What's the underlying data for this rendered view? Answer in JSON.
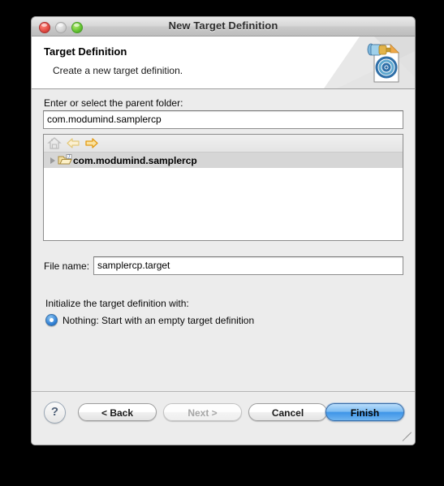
{
  "window": {
    "title": "New Target Definition",
    "controls": [
      {
        "name": "close",
        "icon": "close-traffic-light"
      },
      {
        "name": "minimize",
        "icon": "minimize-traffic-light"
      },
      {
        "name": "zoom",
        "icon": "zoom-traffic-light"
      }
    ]
  },
  "header": {
    "title": "Target Definition",
    "subtitle": "Create a new target definition.",
    "icon": "target-definition-document-icon"
  },
  "form": {
    "parent_folder_label": "Enter or select the parent folder:",
    "parent_folder_value": "com.modumind.samplercp",
    "parent_folder_placeholder": "",
    "file_name_label": "File name:",
    "file_name_value": "samplercp.target",
    "file_name_placeholder": "",
    "initialize_label": "Initialize the target definition with:",
    "radio_option": "Nothing: Start with an empty target definition"
  },
  "tree": {
    "toolbar": [
      {
        "name": "home-icon",
        "label": "Home",
        "enabled": false
      },
      {
        "name": "back-icon",
        "label": "Back",
        "enabled": false
      },
      {
        "name": "forward-icon",
        "label": "Forward",
        "enabled": true
      }
    ],
    "rows": [
      {
        "label": "com.modumind.samplercp",
        "icon": "open-folder-java-icon",
        "expanded": false,
        "selected": true
      }
    ]
  },
  "buttons": {
    "help": "?",
    "back": "< Back",
    "next": "Next >",
    "cancel": "Cancel",
    "finish": "Finish"
  },
  "colors": {
    "accent": "#3e95e8",
    "window_bg": "#ececec",
    "header_bg": "#ffffff",
    "selection": "#d6d6d6",
    "forward_arrow": "#f0a81e"
  }
}
